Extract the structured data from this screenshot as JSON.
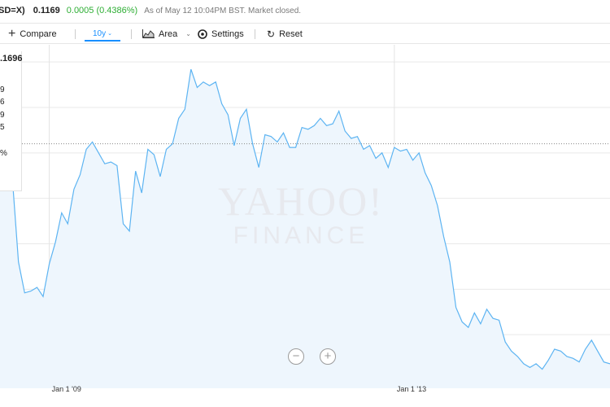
{
  "quote": {
    "symbol": "SD=X)",
    "price": "0.1169",
    "change": "0.0005 (0.4386%)",
    "as_of": "As of May 12 10:04PM BST. Market closed.",
    "change_color": "#2eae34"
  },
  "toolbar": {
    "compare_label": "Compare",
    "range_label": "10y",
    "type_label": "Area",
    "settings_label": "Settings",
    "reset_label": "Reset",
    "accent_color": "#188fff"
  },
  "tooltip": {
    "close_value": ".1696",
    "rows": [
      "9",
      "6",
      "9",
      "5",
      "%"
    ]
  },
  "watermark": {
    "line1": "YAHOO!",
    "line2": "FINANCE"
  },
  "zoom": {
    "out_label": "−",
    "in_label": "+"
  },
  "chart_data": {
    "type": "area",
    "title": "",
    "xlabel": "",
    "ylabel": "",
    "x_ticks": [
      "Jan 1 '09",
      "Jan 1 '13"
    ],
    "previous_close_line": true,
    "grid": "horizontal + vertical at year ticks",
    "line_color": "#5db4f2",
    "fill_color": "#eef6fd",
    "series": [
      {
        "values": [
          0.1755,
          0.1755,
          0.1711,
          0.1665,
          0.1648,
          0.1649,
          0.1651,
          0.1646,
          0.1664,
          0.1676,
          0.1692,
          0.1686,
          0.1705,
          0.1713,
          0.1727,
          0.1731,
          0.1725,
          0.1719,
          0.172,
          0.1718,
          0.1686,
          0.1682,
          0.1715,
          0.1703,
          0.1727,
          0.1724,
          0.1712,
          0.1727,
          0.173,
          0.1744,
          0.1749,
          0.1771,
          0.1761,
          0.1764,
          0.1762,
          0.1764,
          0.1752,
          0.1746,
          0.1729,
          0.1744,
          0.1749,
          0.173,
          0.1717,
          0.1735,
          0.1734,
          0.1731,
          0.1736,
          0.1728,
          0.1728,
          0.1739,
          0.1738,
          0.174,
          0.1744,
          0.174,
          0.1741,
          0.1748,
          0.1737,
          0.1733,
          0.1734,
          0.1727,
          0.1729,
          0.1722,
          0.1725,
          0.1717,
          0.1728,
          0.1726,
          0.1727,
          0.1721,
          0.1725,
          0.1714,
          0.1707,
          0.1696,
          0.1679,
          0.1665,
          0.164,
          0.1632,
          0.1629,
          0.1637,
          0.1631,
          0.1639,
          0.1634,
          0.1633,
          0.1621,
          0.1616,
          0.1613,
          0.1609,
          0.1607,
          0.1609,
          0.1606,
          0.1611,
          0.1617,
          0.1616,
          0.1613,
          0.1612,
          0.161,
          0.1617,
          0.1622,
          0.1616,
          0.161,
          0.1609
        ]
      }
    ],
    "y_domain": [
      0.16,
      0.178
    ],
    "reference_value": 0.173
  }
}
